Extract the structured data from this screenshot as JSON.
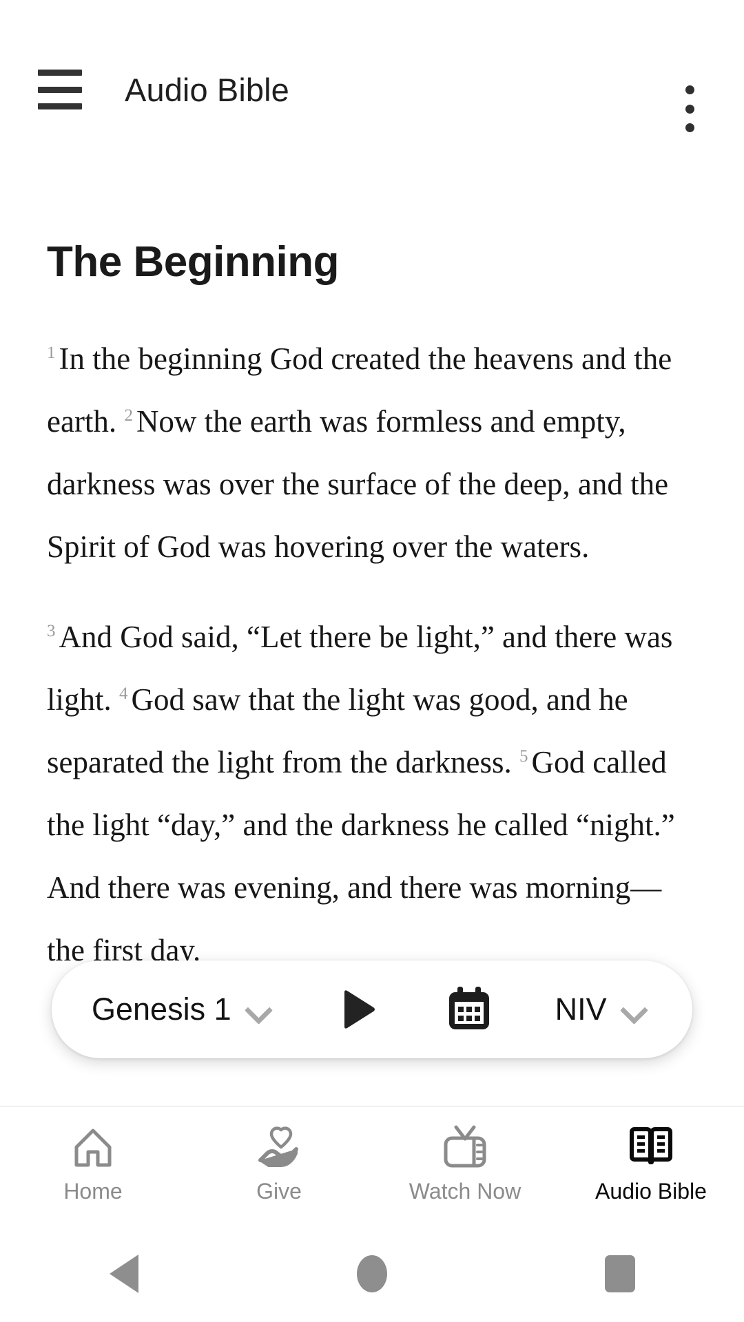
{
  "appbar": {
    "menu_icon": "hamburger-menu-icon",
    "title": "Audio Bible",
    "overflow_icon": "more-vertical-icon"
  },
  "reader": {
    "chapter_title": "The Beginning",
    "paragraphs": [
      {
        "verses": [
          {
            "number": "1",
            "text": "In the beginning God created the heavens and the earth."
          },
          {
            "number": "2",
            "text": "Now the earth was formless and empty, darkness was over the surface of the deep, and the Spirit of God was hovering over the waters."
          }
        ]
      },
      {
        "verses": [
          {
            "number": "3",
            "text": "And God said, “Let there be light,” and there was light."
          },
          {
            "number": "4",
            "text": "God saw that the light was good, and he separated the light from the darkness."
          },
          {
            "number": "5",
            "text": "God called the light “day,” and the darkness he called “night.” And there was evening, and there was morning—the first day."
          }
        ]
      }
    ]
  },
  "player": {
    "reference_label": "Genesis 1",
    "reference_chevron_icon": "chevron-down-icon",
    "play_icon": "play-icon",
    "calendar_icon": "calendar-icon",
    "version_label": "NIV",
    "version_chevron_icon": "chevron-down-icon"
  },
  "tabbar": {
    "items": [
      {
        "label": "Home",
        "icon": "home-icon",
        "active": false
      },
      {
        "label": "Give",
        "icon": "hand-heart-icon",
        "active": false
      },
      {
        "label": "Watch Now",
        "icon": "tv-icon",
        "active": false
      },
      {
        "label": "Audio Bible",
        "icon": "open-book-icon",
        "active": true
      }
    ]
  },
  "sysnav": {
    "back_icon": "triangle-back-icon",
    "home_icon": "circle-home-icon",
    "recents_icon": "square-recents-icon"
  },
  "colors": {
    "text_primary": "#171717",
    "text_muted": "#8b8b8b",
    "verse_number": "#9b9b9b",
    "background": "#ffffff",
    "sysnav_icon": "#8e8e8e"
  }
}
